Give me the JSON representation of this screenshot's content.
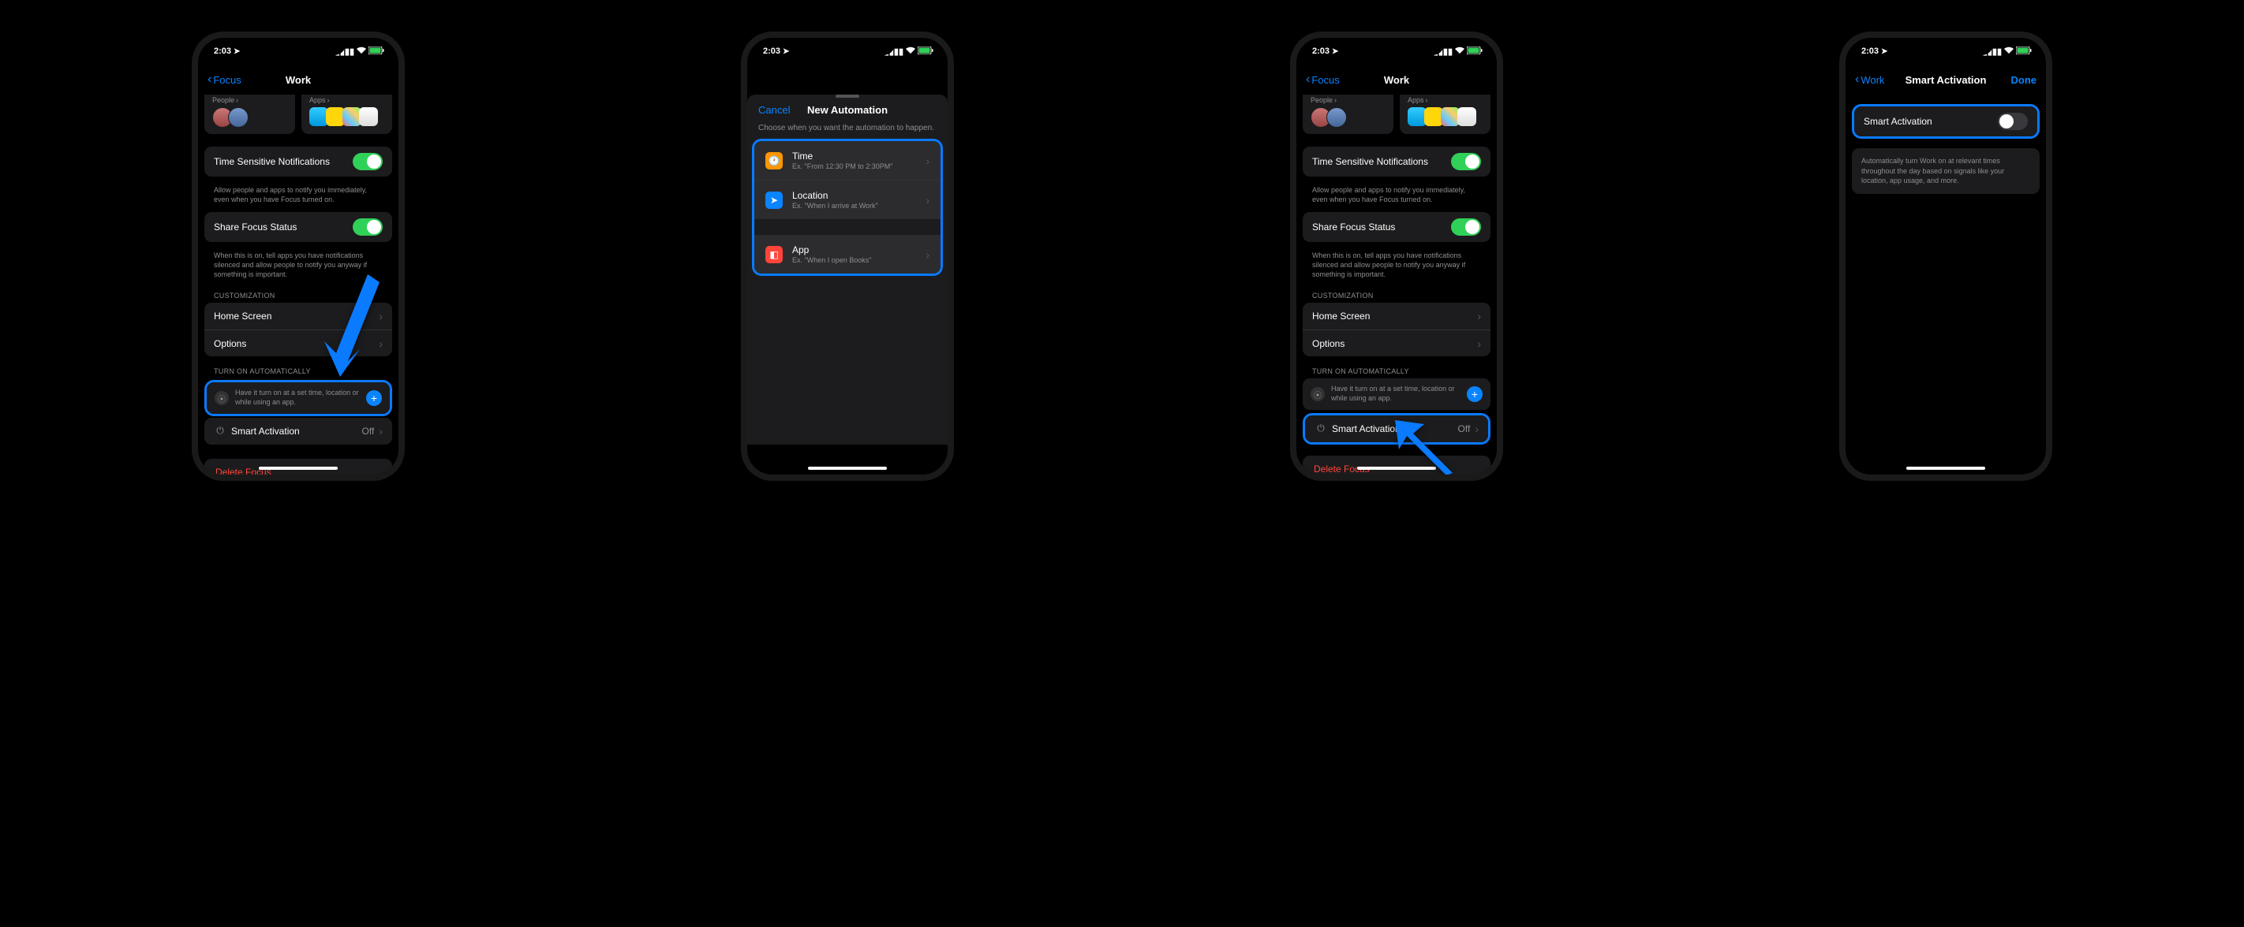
{
  "status": {
    "time": "2:03",
    "location_arrow": "➤"
  },
  "phone1": {
    "back": "Focus",
    "title": "Work",
    "people_label": "People",
    "apps_label": "Apps",
    "tsn_label": "Time Sensitive Notifications",
    "tsn_footer": "Allow people and apps to notify you immediately, even when you have Focus turned on.",
    "share_label": "Share Focus Status",
    "share_footer": "When this is on, tell apps you have notifications silenced and allow people to notify you anyway if something is important.",
    "customization_header": "CUSTOMIZATION",
    "home_screen": "Home Screen",
    "options": "Options",
    "auto_header": "TURN ON AUTOMATICALLY",
    "auto_text": "Have it turn on at a set time, location or while using an app.",
    "smart_activation": "Smart Activation",
    "smart_value": "Off",
    "delete": "Delete Focus"
  },
  "phone2": {
    "cancel": "Cancel",
    "title": "New Automation",
    "subtitle": "Choose when you want the automation to happen.",
    "triggers": [
      {
        "title": "Time",
        "sub": "Ex. \"From 12:30 PM to 2:30PM\"",
        "color": "#ff9500",
        "icon": "🕒"
      },
      {
        "title": "Location",
        "sub": "Ex. \"When I arrive at Work\"",
        "color": "#0a84ff",
        "icon": "➤"
      },
      {
        "title": "App",
        "sub": "Ex. \"When I open Books\"",
        "color": "#ff453a",
        "icon": "◧"
      }
    ]
  },
  "phone3": {
    "back": "Focus",
    "title": "Work",
    "people_label": "People",
    "apps_label": "Apps",
    "tsn_label": "Time Sensitive Notifications",
    "tsn_footer": "Allow people and apps to notify you immediately, even when you have Focus turned on.",
    "share_label": "Share Focus Status",
    "share_footer": "When this is on, tell apps you have notifications silenced and allow people to notify you anyway if something is important.",
    "customization_header": "CUSTOMIZATION",
    "home_screen": "Home Screen",
    "options": "Options",
    "auto_header": "TURN ON AUTOMATICALLY",
    "auto_text": "Have it turn on at a set time, location or while using an app.",
    "smart_activation": "Smart Activation",
    "smart_value": "Off",
    "delete": "Delete Focus"
  },
  "phone4": {
    "back": "Work",
    "title": "Smart Activation",
    "done": "Done",
    "toggle_label": "Smart Activation",
    "desc": "Automatically turn Work on at relevant times throughout the day based on signals like your location, app usage, and more."
  }
}
